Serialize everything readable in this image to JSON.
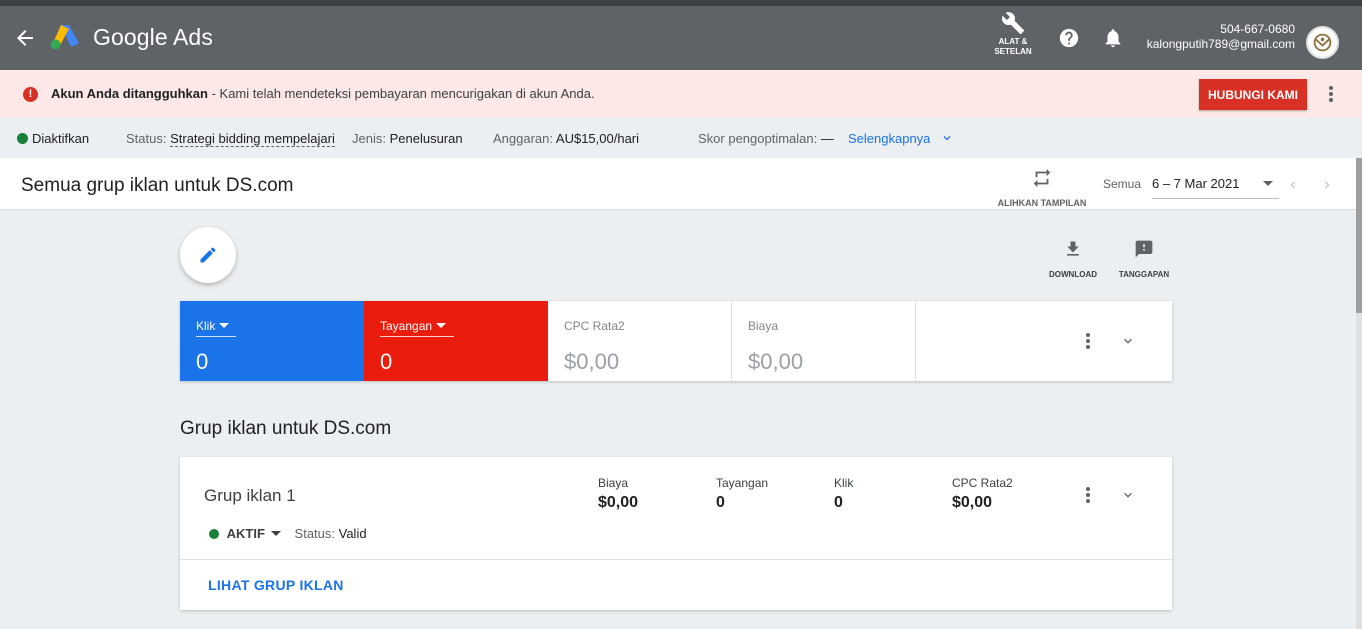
{
  "header": {
    "brand": "Google Ads",
    "tools_label_line1": "ALAT &",
    "tools_label_line2": "SETELAN",
    "phone": "504-667-0680",
    "email": "kalongputih789@gmail.com"
  },
  "alert": {
    "title": "Akun Anda ditangguhkan",
    "message": " - Kami telah mendeteksi pembayaran mencurigakan di akun Anda.",
    "button": "HUBUNGI KAMI"
  },
  "info": {
    "state": "Diaktifkan",
    "status_label": "Status:",
    "status_value": "Strategi bidding mempelajari",
    "type_label": "Jenis:",
    "type_value": "Penelusuran",
    "budget_label": "Anggaran:",
    "budget_value": "AU$15,00/hari",
    "score_label": "Skor pengoptimalan:",
    "score_value": "—",
    "more": "Selengkapnya"
  },
  "titlebar": {
    "title": "Semua grup iklan untuk DS.com",
    "switch_view": "ALIHKAN TAMPILAN",
    "date_label": "Semua",
    "date_range": "6 – 7 Mar 2021"
  },
  "actions": {
    "download": "DOWNLOAD",
    "feedback": "TANGGAPAN"
  },
  "metrics": [
    {
      "label": "Klik",
      "value": "0",
      "color": "#1a73e8"
    },
    {
      "label": "Tayangan",
      "value": "0",
      "color": "#ea1c0d"
    },
    {
      "label": "CPC Rata2",
      "value": "$0,00"
    },
    {
      "label": "Biaya",
      "value": "$0,00"
    }
  ],
  "section": {
    "title": "Grup iklan untuk DS.com"
  },
  "adgroup": {
    "name": "Grup iklan 1",
    "stats": [
      {
        "label": "Biaya",
        "value": "$0,00"
      },
      {
        "label": "Tayangan",
        "value": "0"
      },
      {
        "label": "Klik",
        "value": "0"
      },
      {
        "label": "CPC Rata2",
        "value": "$0,00"
      }
    ],
    "status": "AKTIF",
    "validity_label": "Status:",
    "validity_value": "Valid",
    "link": "LIHAT GRUP IKLAN"
  }
}
